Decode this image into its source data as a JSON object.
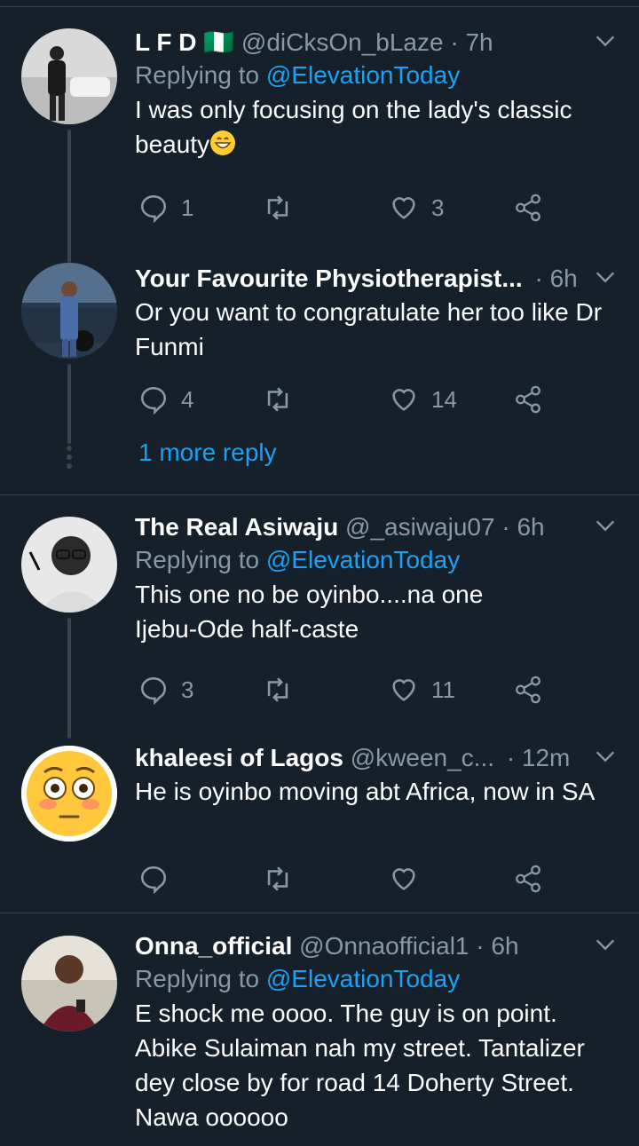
{
  "tweets": [
    {
      "name": "L F D",
      "flag": "🇳🇬",
      "handle": "@diCksOn_bLaze",
      "time": "· 7h",
      "replying_prefix": "Replying to",
      "replying_to": "@ElevationToday",
      "text": "I was only focusing on the lady's classic beauty",
      "replies": "1",
      "retweets": "",
      "likes": "3"
    },
    {
      "name": "Your Favourite Physiotherapist...",
      "handle": "",
      "time": "· 6h",
      "text": "Or you want to congratulate her too like Dr Funmi",
      "replies": "4",
      "retweets": "",
      "likes": "14"
    },
    {
      "name": "The Real Asiwaju",
      "handle": "@_asiwaju07",
      "time": "· 6h",
      "replying_prefix": "Replying to",
      "replying_to": "@ElevationToday",
      "text": "This one no be oyinbo....na one Ijebu-Ode half-caste",
      "replies": "3",
      "retweets": "",
      "likes": "11"
    },
    {
      "name": "khaleesi of Lagos",
      "handle": "@kween_c...",
      "time": "· 12m",
      "text": "He is oyinbo moving abt Africa, now in SA",
      "replies": "",
      "retweets": "",
      "likes": ""
    },
    {
      "name": "Onna_official",
      "handle": "@Onnaofficial1",
      "time": "· 6h",
      "replying_prefix": "Replying to",
      "replying_to": "@ElevationToday",
      "text": "E shock me oooo.  The guy is on point. Abike Sulaiman nah my street. Tantalizer dey close by for road 14 Doherty Street. Nawa oooooo"
    }
  ],
  "more_reply": "1 more reply",
  "colors": {
    "background": "#15202b",
    "accent": "#1da1f2",
    "secondary_text": "#8899a6",
    "divider": "#38444d"
  },
  "icons": [
    "reply-icon",
    "retweet-icon",
    "like-icon",
    "share-icon",
    "chevron-down-icon"
  ]
}
